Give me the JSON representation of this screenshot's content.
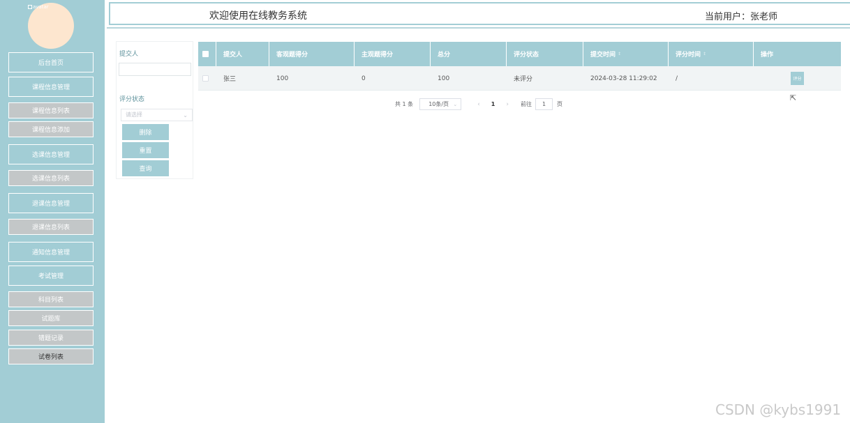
{
  "header": {
    "title": "欢迎使用在线教务系统",
    "user": "当前用户：张老师"
  },
  "sidebar": {
    "avatar_alt": "avatar",
    "items": [
      {
        "label": "后台首页",
        "type": "main"
      },
      {
        "label": "课程信息管理",
        "type": "main"
      },
      {
        "label": "课程信息列表",
        "type": "sub"
      },
      {
        "label": "课程信息添加",
        "type": "sub"
      },
      {
        "label": "选课信息管理",
        "type": "main"
      },
      {
        "label": "选课信息列表",
        "type": "sub"
      },
      {
        "label": "退课信息管理",
        "type": "main"
      },
      {
        "label": "退课信息列表",
        "type": "sub"
      },
      {
        "label": "通知信息管理",
        "type": "main"
      },
      {
        "label": "考试管理",
        "type": "main"
      },
      {
        "label": "科目列表",
        "type": "sub"
      },
      {
        "label": "试题库",
        "type": "sub"
      },
      {
        "label": "错题记录",
        "type": "sub"
      },
      {
        "label": "试卷列表",
        "type": "sub",
        "active": true
      }
    ]
  },
  "filters": {
    "submitter_label": "提交人",
    "submitter_value": "",
    "status_label": "评分状态",
    "status_placeholder": "请选择",
    "delete_label": "删除",
    "reset_label": "重置",
    "search_label": "查询"
  },
  "table": {
    "headers": [
      "提交人",
      "客观题得分",
      "主观题得分",
      "总分",
      "评分状态",
      "提交时间",
      "评分时间",
      "操作"
    ],
    "rows": [
      {
        "submitter": "张三",
        "objective": "100",
        "subjective": "0",
        "total": "100",
        "status": "未评分",
        "submit_time": "2024-03-28 11:29:02",
        "score_time": "/",
        "action": "评分"
      }
    ]
  },
  "pagination": {
    "total": "共 1 条",
    "page_size": "10条/页",
    "prev": "‹",
    "current": "1",
    "next": "›",
    "goto_label": "前往",
    "goto_value": "1",
    "page_suffix": "页"
  },
  "watermark": "CSDN @kybs1991",
  "colors": {
    "sidebar": "#a2cdd5",
    "submenu": "#c3c7c8",
    "avatar": "#fde6cf",
    "table_header": "#a2cdd5"
  }
}
